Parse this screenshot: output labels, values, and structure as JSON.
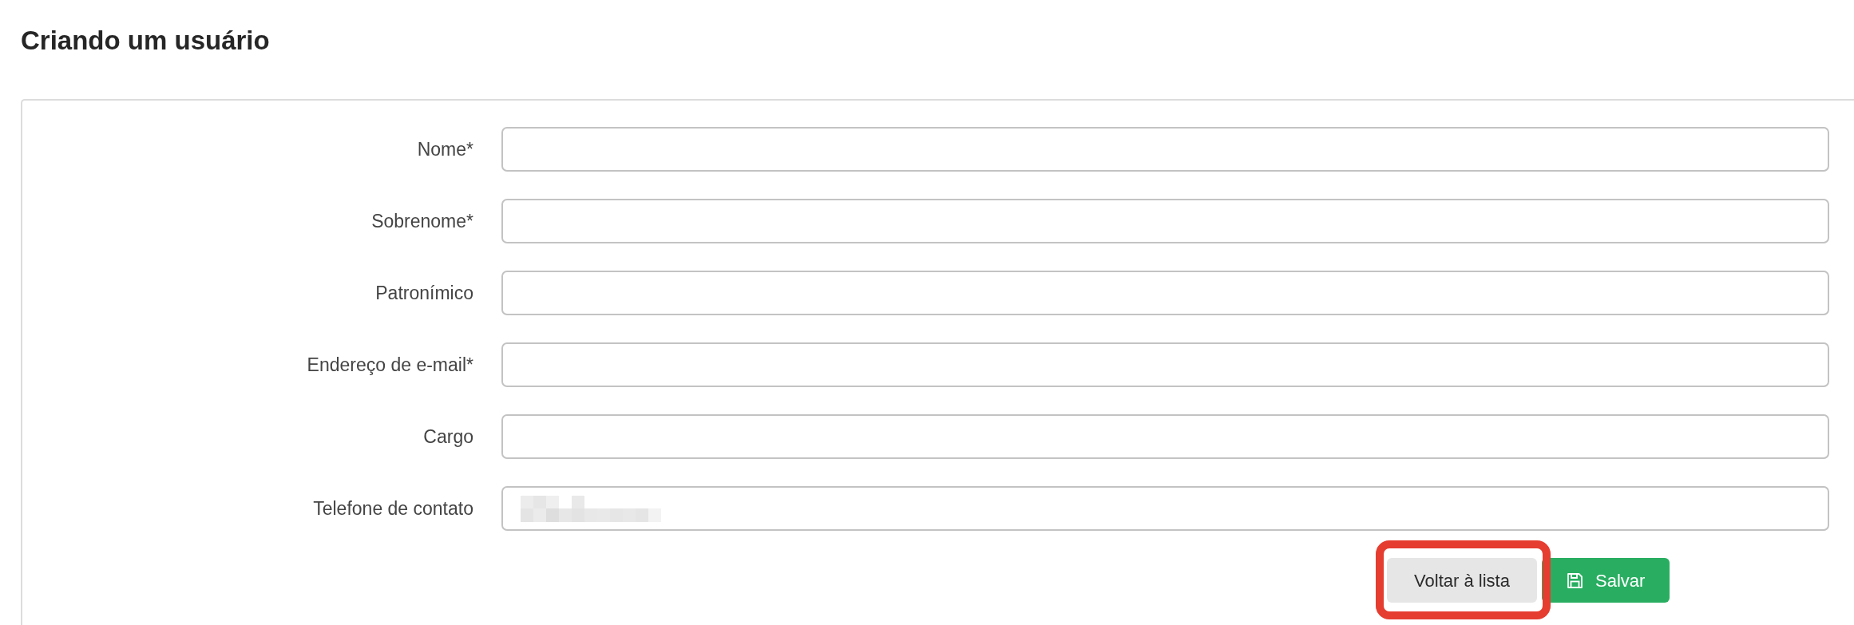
{
  "page": {
    "title": "Criando um usuário"
  },
  "form": {
    "fields": [
      {
        "label": "Nome*",
        "redacted": false
      },
      {
        "label": "Sobrenome*",
        "redacted": false
      },
      {
        "label": "Patronímico",
        "redacted": false
      },
      {
        "label": "Endereço de e-mail*",
        "redacted": false
      },
      {
        "label": "Cargo",
        "redacted": false
      },
      {
        "label": "Telefone de contato",
        "redacted": true
      }
    ]
  },
  "buttons": [
    {
      "kind": "back",
      "label": "Voltar à lista",
      "highlighted": true
    },
    {
      "kind": "save",
      "label": "Salvar",
      "highlighted": false
    }
  ]
}
